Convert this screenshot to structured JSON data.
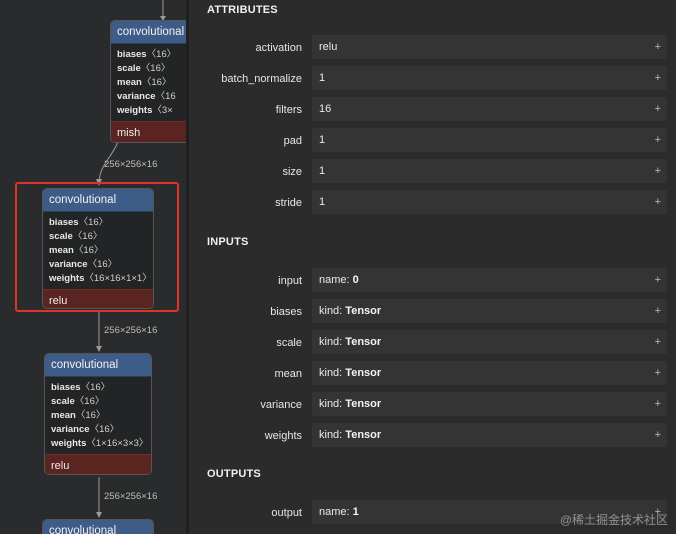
{
  "graph": {
    "nodes": [
      {
        "title": "convolutional",
        "attrs": [
          {
            "name": "biases",
            "value": "〈16〉"
          },
          {
            "name": "scale",
            "value": "〈16〉"
          },
          {
            "name": "mean",
            "value": "〈16〉"
          },
          {
            "name": "variance",
            "value": "〈16"
          },
          {
            "name": "weights",
            "value": "〈3×"
          }
        ],
        "activation": "mish"
      },
      {
        "title": "convolutional",
        "attrs": [
          {
            "name": "biases",
            "value": "〈16〉"
          },
          {
            "name": "scale",
            "value": "〈16〉"
          },
          {
            "name": "mean",
            "value": "〈16〉"
          },
          {
            "name": "variance",
            "value": "〈16〉"
          },
          {
            "name": "weights",
            "value": "〈16×16×1×1〉"
          }
        ],
        "activation": "relu"
      },
      {
        "title": "convolutional",
        "attrs": [
          {
            "name": "biases",
            "value": "〈16〉"
          },
          {
            "name": "scale",
            "value": "〈16〉"
          },
          {
            "name": "mean",
            "value": "〈16〉"
          },
          {
            "name": "variance",
            "value": "〈16〉"
          },
          {
            "name": "weights",
            "value": "〈1×16×3×3〉"
          }
        ],
        "activation": "relu"
      },
      {
        "title": "convolutional"
      }
    ],
    "edge_labels": [
      "256×256×16",
      "256×256×16",
      "256×256×16"
    ]
  },
  "properties": {
    "attributes_title": "ATTRIBUTES",
    "attributes": [
      {
        "label": "activation",
        "value": "relu"
      },
      {
        "label": "batch_normalize",
        "value": "1"
      },
      {
        "label": "filters",
        "value": "16"
      },
      {
        "label": "pad",
        "value": "1"
      },
      {
        "label": "size",
        "value": "1"
      },
      {
        "label": "stride",
        "value": "1"
      }
    ],
    "inputs_title": "INPUTS",
    "inputs": [
      {
        "label": "input",
        "prefix": "name: ",
        "value": "0"
      },
      {
        "label": "biases",
        "prefix": "kind: ",
        "value": "Tensor"
      },
      {
        "label": "scale",
        "prefix": "kind: ",
        "value": "Tensor"
      },
      {
        "label": "mean",
        "prefix": "kind: ",
        "value": "Tensor"
      },
      {
        "label": "variance",
        "prefix": "kind: ",
        "value": "Tensor"
      },
      {
        "label": "weights",
        "prefix": "kind: ",
        "value": "Tensor"
      }
    ],
    "outputs_title": "OUTPUTS",
    "outputs": [
      {
        "label": "output",
        "prefix": "name: ",
        "value": "1"
      }
    ],
    "expand_glyph": "+"
  },
  "watermark": "@稀土掘金技术社区"
}
